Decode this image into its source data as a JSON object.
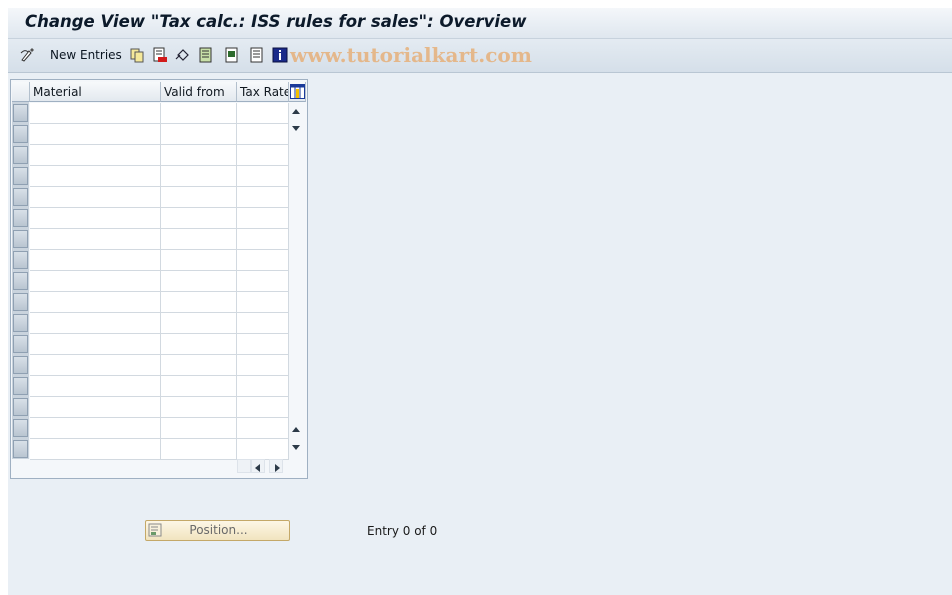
{
  "window": {
    "title": "Change View \"Tax calc.: ISS rules for sales\": Overview"
  },
  "toolbar": {
    "new_entries_label": "New Entries",
    "watermark": "www.tutorialkart.com",
    "icons": [
      "display-change-icon",
      "copy-icon",
      "delete-icon",
      "undo-icon",
      "select-all-icon",
      "select-block-icon",
      "deselect-all-icon",
      "info-icon"
    ]
  },
  "table": {
    "columns": [
      "Material",
      "Valid from",
      "Tax Rate"
    ],
    "rows": [
      [
        "",
        "",
        ""
      ],
      [
        "",
        "",
        ""
      ],
      [
        "",
        "",
        ""
      ],
      [
        "",
        "",
        ""
      ],
      [
        "",
        "",
        ""
      ],
      [
        "",
        "",
        ""
      ],
      [
        "",
        "",
        ""
      ],
      [
        "",
        "",
        ""
      ],
      [
        "",
        "",
        ""
      ],
      [
        "",
        "",
        ""
      ],
      [
        "",
        "",
        ""
      ],
      [
        "",
        "",
        ""
      ],
      [
        "",
        "",
        ""
      ],
      [
        "",
        "",
        ""
      ],
      [
        "",
        "",
        ""
      ],
      [
        "",
        "",
        ""
      ],
      [
        "",
        "",
        ""
      ]
    ]
  },
  "footer": {
    "position_label": "Position...",
    "entry_text": "Entry 0 of 0"
  },
  "colors": {
    "background": "#e9eff5",
    "title_text": "#0c1a2a",
    "position_button": "#f1e4bf"
  }
}
